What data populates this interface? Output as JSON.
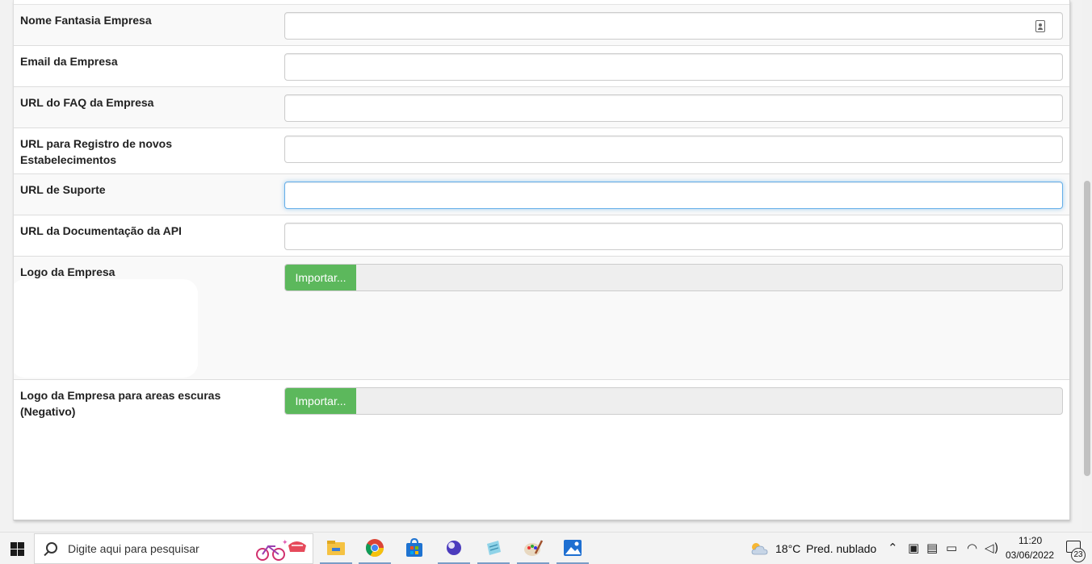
{
  "form": {
    "rows": [
      {
        "label": "Nome Fantasia Empresa",
        "value": "",
        "has_autofill_icon": true
      },
      {
        "label": "Email da Empresa",
        "value": ""
      },
      {
        "label": "URL do FAQ da Empresa",
        "value": ""
      },
      {
        "label": "URL para Registro de novos Estabelecimentos",
        "value": ""
      },
      {
        "label": "URL de Suporte",
        "value": "",
        "focused": true
      },
      {
        "label": "URL da Documentação da API",
        "value": ""
      }
    ],
    "logo": {
      "label": "Logo da Empresa",
      "button_label": "Importar..."
    },
    "logo_dark": {
      "label": "Logo da Empresa para areas escuras (Negativo)",
      "button_label": "Importar..."
    }
  },
  "colors": {
    "import_button": "#5cb85c",
    "focus_border": "#66afe9",
    "row_stripe": "#f9f9f9"
  },
  "taskbar": {
    "search_placeholder": "Digite aqui para pesquisar",
    "apps": [
      "file-explorer-icon",
      "chrome-icon",
      "microsoft-store-icon",
      "app-purple-icon",
      "notepad-icon",
      "paint-icon",
      "photos-icon"
    ],
    "weather": {
      "temperature": "18°C",
      "condition": "Pred. nublado"
    },
    "time": "11:20",
    "date": "03/06/2022",
    "notification_count": "23"
  }
}
